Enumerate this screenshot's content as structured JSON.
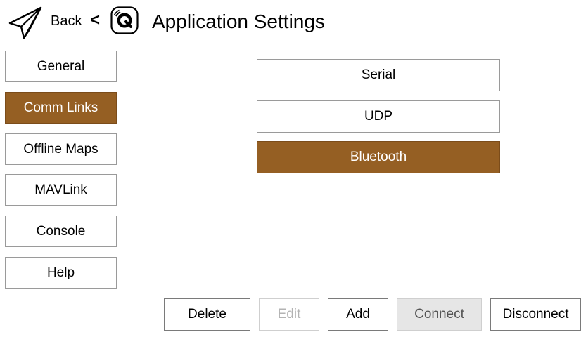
{
  "header": {
    "back_label": "Back",
    "back_chevron": "<",
    "title": "Application Settings",
    "icons": {
      "plane": "paper-plane-icon",
      "logo": "qgc-logo-icon"
    }
  },
  "sidebar": {
    "items": [
      {
        "label": "General",
        "active": false
      },
      {
        "label": "Comm Links",
        "active": true
      },
      {
        "label": "Offline Maps",
        "active": false
      },
      {
        "label": "MAVLink",
        "active": false
      },
      {
        "label": "Console",
        "active": false
      },
      {
        "label": "Help",
        "active": false
      }
    ]
  },
  "links": {
    "items": [
      {
        "label": "Serial",
        "selected": false
      },
      {
        "label": "UDP",
        "selected": false
      },
      {
        "label": "Bluetooth",
        "selected": true
      }
    ]
  },
  "actions": {
    "delete": "Delete",
    "edit": "Edit",
    "add": "Add",
    "connect": "Connect",
    "disconnect": "Disconnect"
  },
  "colors": {
    "accent": "#955f23",
    "accent_text": "#ffffff",
    "border": "#9a9a9a",
    "disabled_text": "#b3b3b3",
    "greyed_bg": "#e6e6e6"
  }
}
